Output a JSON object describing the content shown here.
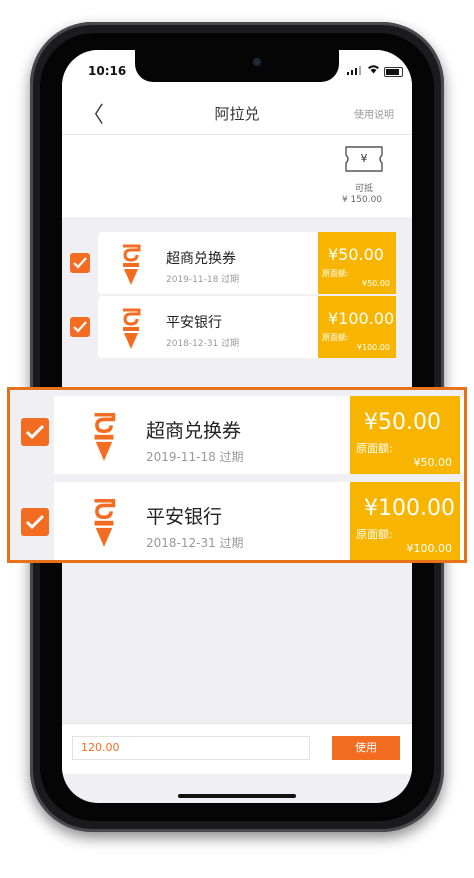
{
  "status_bar": {
    "time": "10:16"
  },
  "nav": {
    "back_glyph": "〈",
    "title": "阿拉兑",
    "help": "使用说明"
  },
  "summary": {
    "icon": "yen-ticket-icon",
    "ticket_symbol": "¥",
    "label": "可抵",
    "amount": "¥ 150.00"
  },
  "coupons": [
    {
      "checked": true,
      "name": "超商兑换券",
      "expiry": "2019-11-18 过期",
      "amount": "¥50.00",
      "face_label": "原面额:",
      "face_value": "¥50.00"
    },
    {
      "checked": true,
      "name": "平安银行",
      "expiry": "2018-12-31 过期",
      "amount": "¥100.00",
      "face_label": "原面额:",
      "face_value": "¥100.00"
    }
  ],
  "bottom": {
    "amount_value": "120.00",
    "use_label": "使用"
  },
  "colors": {
    "accent": "#f26d21",
    "coupon_gold": "#f7b500",
    "background": "#efeff4",
    "zoom_border": "#e6731c"
  }
}
